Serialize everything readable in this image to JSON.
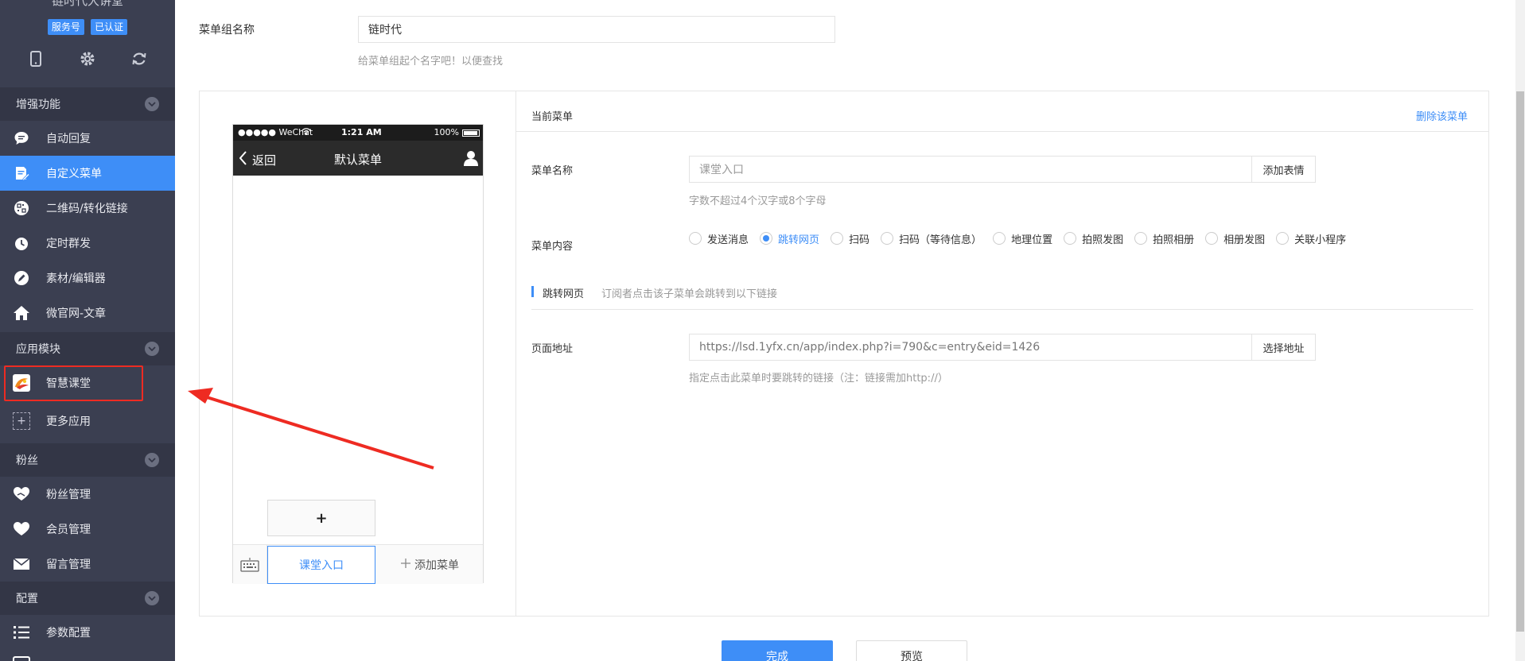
{
  "sidebar": {
    "account_name": "链时代大讲堂",
    "badges": [
      "服务号",
      "已认证"
    ],
    "tools": [
      {
        "icon": "mobile-icon"
      },
      {
        "icon": "gear-icon"
      },
      {
        "icon": "refresh-icon"
      }
    ],
    "sections": {
      "enhance": "增强功能",
      "apps": "应用模块",
      "fans": "粉丝",
      "config": "配置"
    },
    "items": {
      "auto_reply": "自动回复",
      "custom_menu": "自定义菜单",
      "qrcode": "二维码/转化链接",
      "scheduled": "定时群发",
      "material": "素材/编辑器",
      "micro_site": "微官网-文章",
      "smart_class": "智慧课堂",
      "more_apps": "更多应用",
      "fans_mgmt": "粉丝管理",
      "member_mgmt": "会员管理",
      "message_mgmt": "留言管理",
      "param_config": "参数配置"
    },
    "active_item": "custom_menu",
    "more_plus": "+"
  },
  "form": {
    "group_name_label": "菜单组名称",
    "group_name_value": "链时代",
    "group_name_hint": "给菜单组起个名字吧！以便查找"
  },
  "phone": {
    "carrier": "●●●●● WeChat",
    "time": "1:21 AM",
    "battery": "100%",
    "back": "返回",
    "title": "默认菜单",
    "plus": "+",
    "menu_tab": "课堂入口",
    "add_menu": "添加菜单"
  },
  "editor": {
    "current_menu": "当前菜单",
    "delete_menu": "删除该菜单",
    "name_label": "菜单名称",
    "name_placeholder": "课堂入口",
    "emoji_btn": "添加表情",
    "name_hint": "字数不超过4个汉字或8个字母",
    "content_label": "菜单内容",
    "options": [
      "发送消息",
      "跳转网页",
      "扫码",
      "扫码（等待信息）",
      "地理位置",
      "拍照发图",
      "拍照相册",
      "相册发图",
      "关联小程序"
    ],
    "selected_option": "跳转网页",
    "sub_title": "跳转网页",
    "sub_desc": "订阅者点击该子菜单会跳转到以下链接",
    "url_label": "页面地址",
    "url_value": "https://lsd.1yfx.cn/app/index.php?i=790&c=entry&eid=1426",
    "select_url_btn": "选择地址",
    "url_hint": "指定点击此菜单时要跳转的链接（注：链接需加http://）"
  },
  "actions": {
    "done": "完成",
    "preview": "预览"
  },
  "colors": {
    "sidebar_bg": "#3b3f51",
    "accent": "#3e8ef7",
    "annotation_red": "#ee2b22"
  }
}
